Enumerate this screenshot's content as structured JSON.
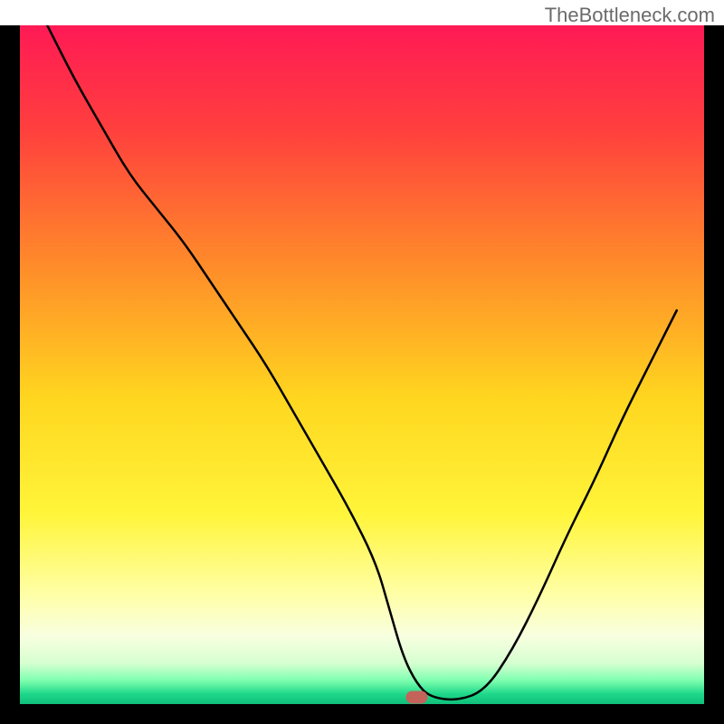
{
  "watermark": "TheBottleneck.com",
  "chart_data": {
    "type": "line",
    "title": "",
    "xlabel": "",
    "ylabel": "",
    "xlim": [
      0,
      100
    ],
    "ylim": [
      0,
      100
    ],
    "background_gradient": {
      "stops": [
        {
          "offset": 0.0,
          "color": "#ff1a55"
        },
        {
          "offset": 0.15,
          "color": "#ff3e3e"
        },
        {
          "offset": 0.35,
          "color": "#ff8a2a"
        },
        {
          "offset": 0.55,
          "color": "#ffd61f"
        },
        {
          "offset": 0.72,
          "color": "#fff53a"
        },
        {
          "offset": 0.84,
          "color": "#ffffa8"
        },
        {
          "offset": 0.9,
          "color": "#f8ffe0"
        },
        {
          "offset": 0.94,
          "color": "#d6ffd0"
        },
        {
          "offset": 0.965,
          "color": "#7fffb0"
        },
        {
          "offset": 0.985,
          "color": "#1fd88a"
        },
        {
          "offset": 1.0,
          "color": "#0fbf7a"
        }
      ]
    },
    "series": [
      {
        "name": "bottleneck-curve",
        "x": [
          4,
          8,
          12,
          16,
          20,
          24,
          28,
          32,
          36,
          40,
          44,
          48,
          52,
          54,
          56,
          58,
          60,
          64,
          68,
          72,
          76,
          80,
          84,
          88,
          92,
          96
        ],
        "y": [
          100,
          92,
          85,
          78,
          73,
          68,
          62,
          56,
          50,
          43,
          36,
          29,
          21,
          14,
          7,
          3,
          1,
          0.5,
          2,
          8,
          16,
          25,
          33,
          42,
          50,
          58
        ]
      }
    ],
    "marker": {
      "name": "optimal-point",
      "x": 58,
      "y": 1.0,
      "color": "#c4635a"
    },
    "frame": {
      "left": true,
      "right": true,
      "top": false,
      "bottom": true,
      "stroke_width_px": 22,
      "color": "#000000"
    }
  }
}
